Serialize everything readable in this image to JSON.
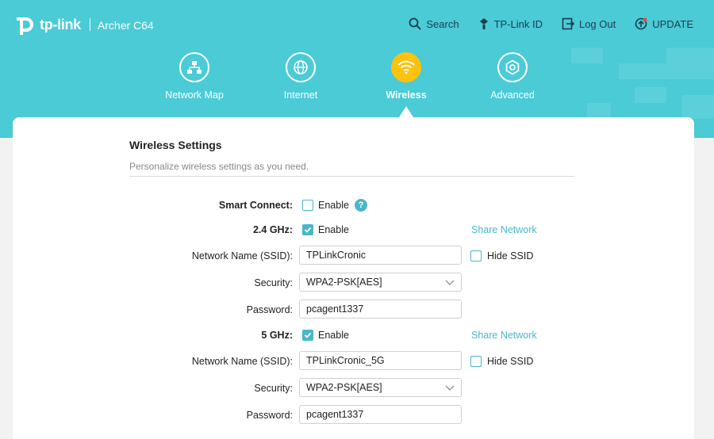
{
  "header": {
    "brand": "tp-link",
    "model": "Archer C64",
    "links": [
      {
        "label": "Search",
        "icon": "search-icon"
      },
      {
        "label": "TP-Link ID",
        "icon": "tplink-id-icon"
      },
      {
        "label": "Log Out",
        "icon": "logout-icon"
      },
      {
        "label": "UPDATE",
        "icon": "update-icon"
      }
    ]
  },
  "nav": {
    "items": [
      {
        "label": "Network Map",
        "icon": "network-map-icon"
      },
      {
        "label": "Internet",
        "icon": "globe-icon"
      },
      {
        "label": "Wireless",
        "icon": "wifi-icon",
        "active": true
      },
      {
        "label": "Advanced",
        "icon": "gear-icon"
      }
    ]
  },
  "colors": {
    "header_bg": "#4acbd6",
    "accent": "#49b7c9",
    "active_nav": "#ffc20e"
  },
  "section": {
    "title": "Wireless Settings",
    "description": "Personalize wireless settings as you need."
  },
  "form": {
    "smart_connect": {
      "label": "Smart Connect:",
      "enable_label": "Enable",
      "checked": false,
      "help": "?"
    },
    "band24": {
      "label": "2.4 GHz:",
      "enable_label": "Enable",
      "checked": true,
      "share_label": "Share Network",
      "ssid_label": "Network Name (SSID):",
      "ssid": "TPLinkCronic",
      "hide_ssid_label": "Hide SSID",
      "hide_ssid": false,
      "security_label": "Security:",
      "security": "WPA2-PSK[AES]",
      "password_label": "Password:",
      "password": "pcagent1337"
    },
    "band5": {
      "label": "5 GHz:",
      "enable_label": "Enable",
      "checked": true,
      "share_label": "Share Network",
      "ssid_label": "Network Name (SSID):",
      "ssid": "TPLinkCronic_5G",
      "hide_ssid_label": "Hide SSID",
      "hide_ssid": false,
      "security_label": "Security:",
      "security": "WPA2-PSK[AES]",
      "password_label": "Password:",
      "password": "pcagent1337"
    }
  }
}
